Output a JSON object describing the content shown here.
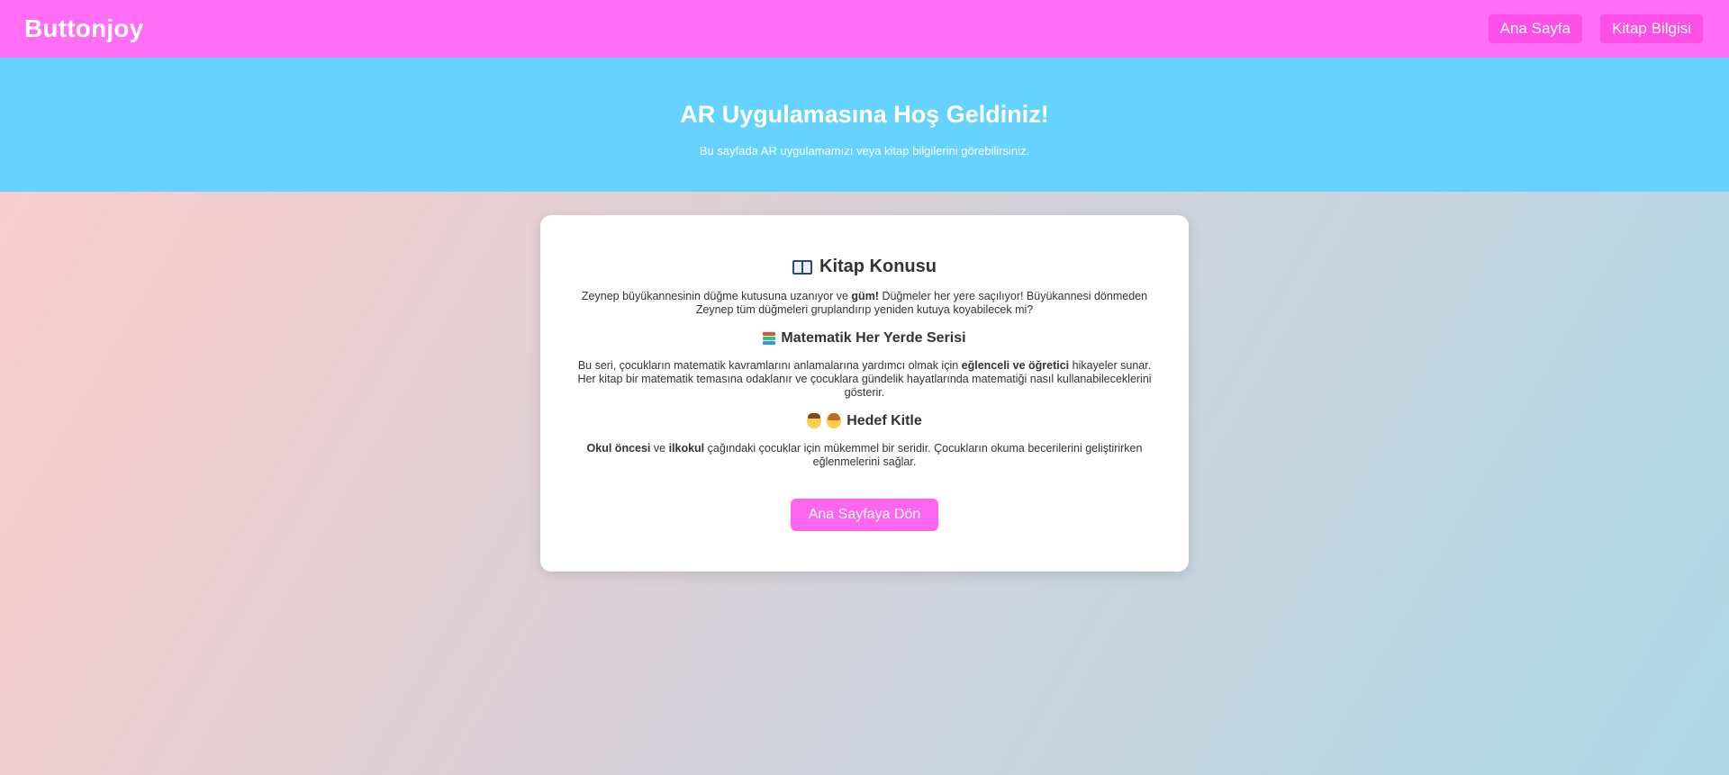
{
  "header": {
    "brand": "Buttonjoy",
    "nav": [
      "Ana Sayfa",
      "Kitap Bilgisi"
    ]
  },
  "hero": {
    "title": "AR Uygulamasına Hoş Geldiniz!",
    "subtitle": "Bu sayfada AR uygulamamızı veya kitap bilgilerini görebilirsiniz."
  },
  "card": {
    "section1": {
      "title": "Kitap Konusu",
      "icon": "open-book-icon",
      "text_before": "Zeynep büyükannesinin düğme kutusuna uzanıyor ve ",
      "text_bold": "güm!",
      "text_after": " Düğmeler her yere saçılıyor! Büyükannesi dönmeden Zeynep tüm düğmeleri gruplandırıp yeniden kutuya koyabilecek mi?"
    },
    "section2": {
      "title": "Matematik Her Yerde Serisi",
      "icon": "books-icon",
      "text_before": "Bu seri, çocukların matematik kavramlarını anlamalarına yardımcı olmak için ",
      "text_bold": "eğlenceli ve öğretici",
      "text_after": " hikayeler sunar. Her kitap bir matematik temasına odaklanır ve çocuklara gündelik hayatlarında matematiği nasıl kullanabileceklerini gösterir."
    },
    "section3": {
      "title": "Hedef Kitle",
      "icons": [
        "boy-icon",
        "girl-icon"
      ],
      "bold1": "Okul öncesi",
      "mid": " ve ",
      "bold2": "ilkokul",
      "text_after": " çağındaki çocuklar için mükemmel bir seridir. Çocukların okuma becerilerini geliştirirken eğlenmelerini sağlar."
    },
    "button": "Ana Sayfaya Dön"
  },
  "colors": {
    "header_bg": "#ff6ef5",
    "nav_button_bg": "#ff4fe9",
    "hero_bg": "#66d2ff",
    "cta_bg": "#ff66f0"
  }
}
